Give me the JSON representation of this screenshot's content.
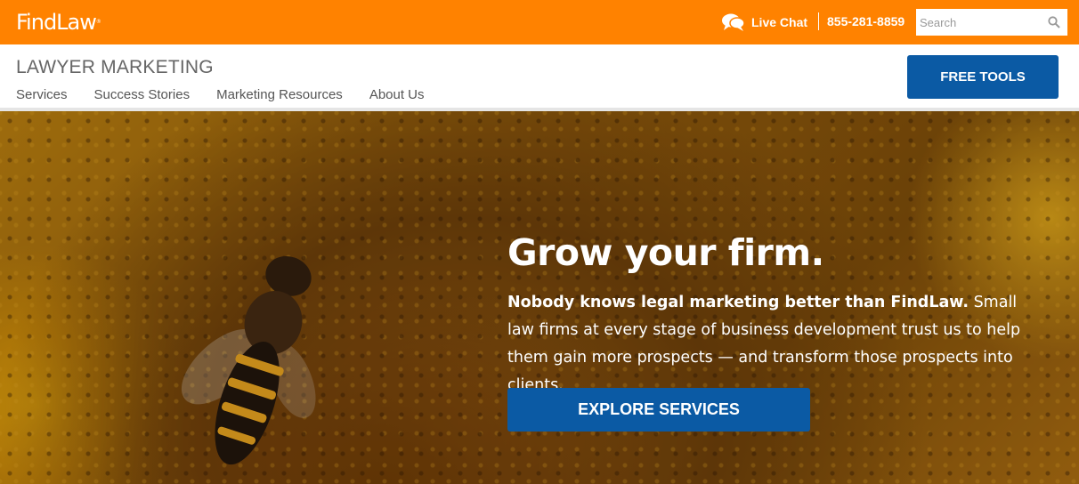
{
  "header": {
    "logo": "FindLaw",
    "logo_mark": "®",
    "live_chat_label": "Live Chat",
    "phone": "855-281-8859",
    "search_placeholder": "Search"
  },
  "subheader": {
    "title": "LAWYER MARKETING",
    "nav": [
      "Services",
      "Success Stories",
      "Marketing Resources",
      "About Us"
    ],
    "free_tools_label": "FREE TOOLS"
  },
  "hero": {
    "title": "Grow your firm.",
    "lead_bold": "Nobody knows legal marketing better than FindLaw.",
    "lead_text": " Small law firms at every stage of business development trust us to help them gain more prospects — and transform those prospects into clients.",
    "cta_label": "EXPLORE SERVICES"
  },
  "colors": {
    "brand_orange": "#ff8200",
    "button_blue": "#0b5aa4"
  },
  "icons": [
    "chat-bubbles-icon",
    "search-icon"
  ]
}
